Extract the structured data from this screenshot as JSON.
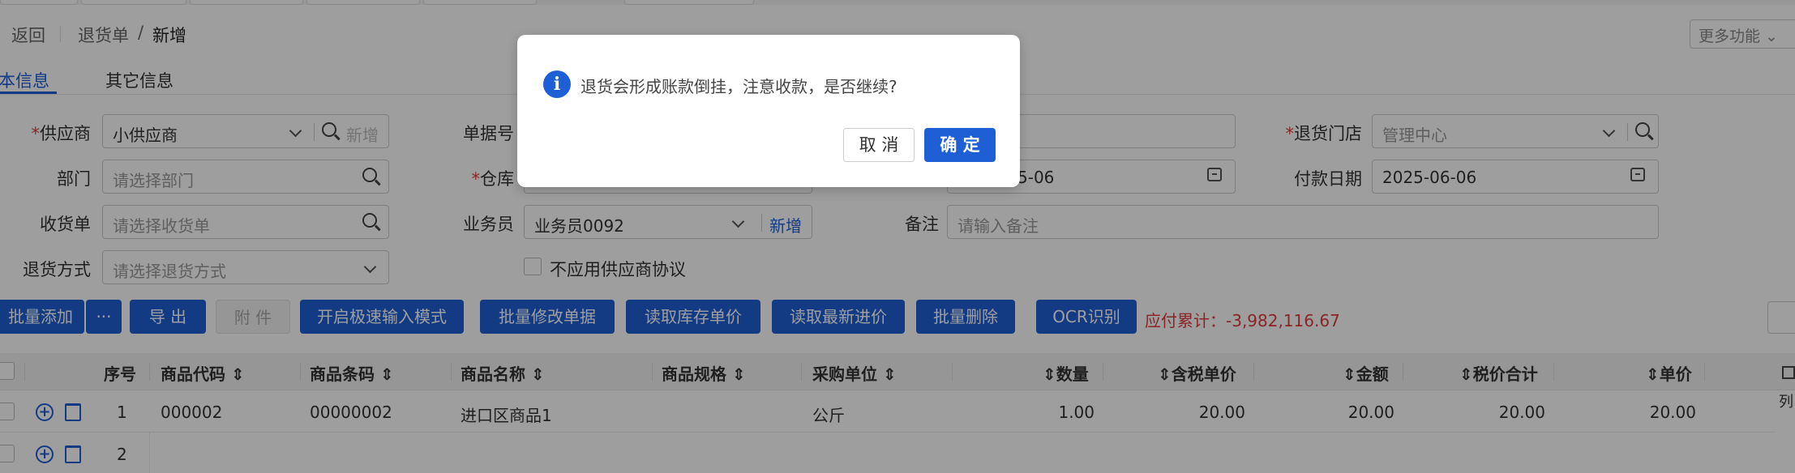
{
  "header": {
    "back_label": "返回",
    "breadcrumb": [
      "退货单",
      "/",
      "新增"
    ],
    "more_label": "更多功能"
  },
  "tabs": [
    {
      "label": "本信息",
      "active": true
    },
    {
      "label": "其它信息",
      "active": false
    }
  ],
  "form": {
    "supplier": {
      "label": "供应商",
      "value": "小供应商",
      "add_label": "新增"
    },
    "doc_no": {
      "label": "单据号"
    },
    "return_store": {
      "label": "退货门店",
      "value": "管理中心"
    },
    "department": {
      "label": "部门",
      "placeholder": "请选择部门"
    },
    "warehouse": {
      "label": "仓库"
    },
    "date_partial": {
      "value": "5-06"
    },
    "payment_date": {
      "label": "付款日期",
      "value": "2025-06-06"
    },
    "receipt": {
      "label": "收货单",
      "placeholder": "请选择收货单"
    },
    "salesman": {
      "label": "业务员",
      "value": "业务员0092",
      "add_label": "新增"
    },
    "remark": {
      "label": "备注",
      "placeholder": "请输入备注"
    },
    "return_method": {
      "label": "退货方式",
      "placeholder": "请选择退货方式"
    },
    "no_agreement": {
      "label": "不应用供应商协议"
    }
  },
  "toolbar": {
    "batch_add": "批量添加",
    "more": "···",
    "export": "导 出",
    "attach": "附 件",
    "fast_input": "开启极速输入模式",
    "batch_modify": "批量修改单据",
    "read_stock_price": "读取库存单价",
    "read_latest_price": "读取最新进价",
    "batch_delete": "批量删除",
    "ocr": "OCR识别",
    "payable": "应付累计：-3,982,116.67"
  },
  "table": {
    "headers": {
      "seq": "序号",
      "code": "商品代码",
      "barcode": "商品条码",
      "name": "商品名称",
      "spec": "商品规格",
      "unit": "采购单位",
      "qty": "数量",
      "tax_price": "含税单价",
      "amount": "金额",
      "total": "税价合计",
      "price": "单价"
    },
    "rows": [
      {
        "seq": "1",
        "code": "000002",
        "barcode": "00000002",
        "name": "进口区商品1",
        "unit": "公斤",
        "qty": "1.00",
        "tax_price": "20.00",
        "amount": "20.00",
        "total": "20.00",
        "price": "20.00"
      },
      {
        "seq": "2"
      }
    ],
    "col_setting_label": "列"
  },
  "dialog": {
    "message": "退货会形成账款倒挂，注意收款，是否继续?",
    "cancel": "取 消",
    "ok": "确 定"
  },
  "colors": {
    "primary": "#1f5fd6",
    "danger": "#e03c3c",
    "overlay": "rgba(0,0,0,0.38)"
  }
}
